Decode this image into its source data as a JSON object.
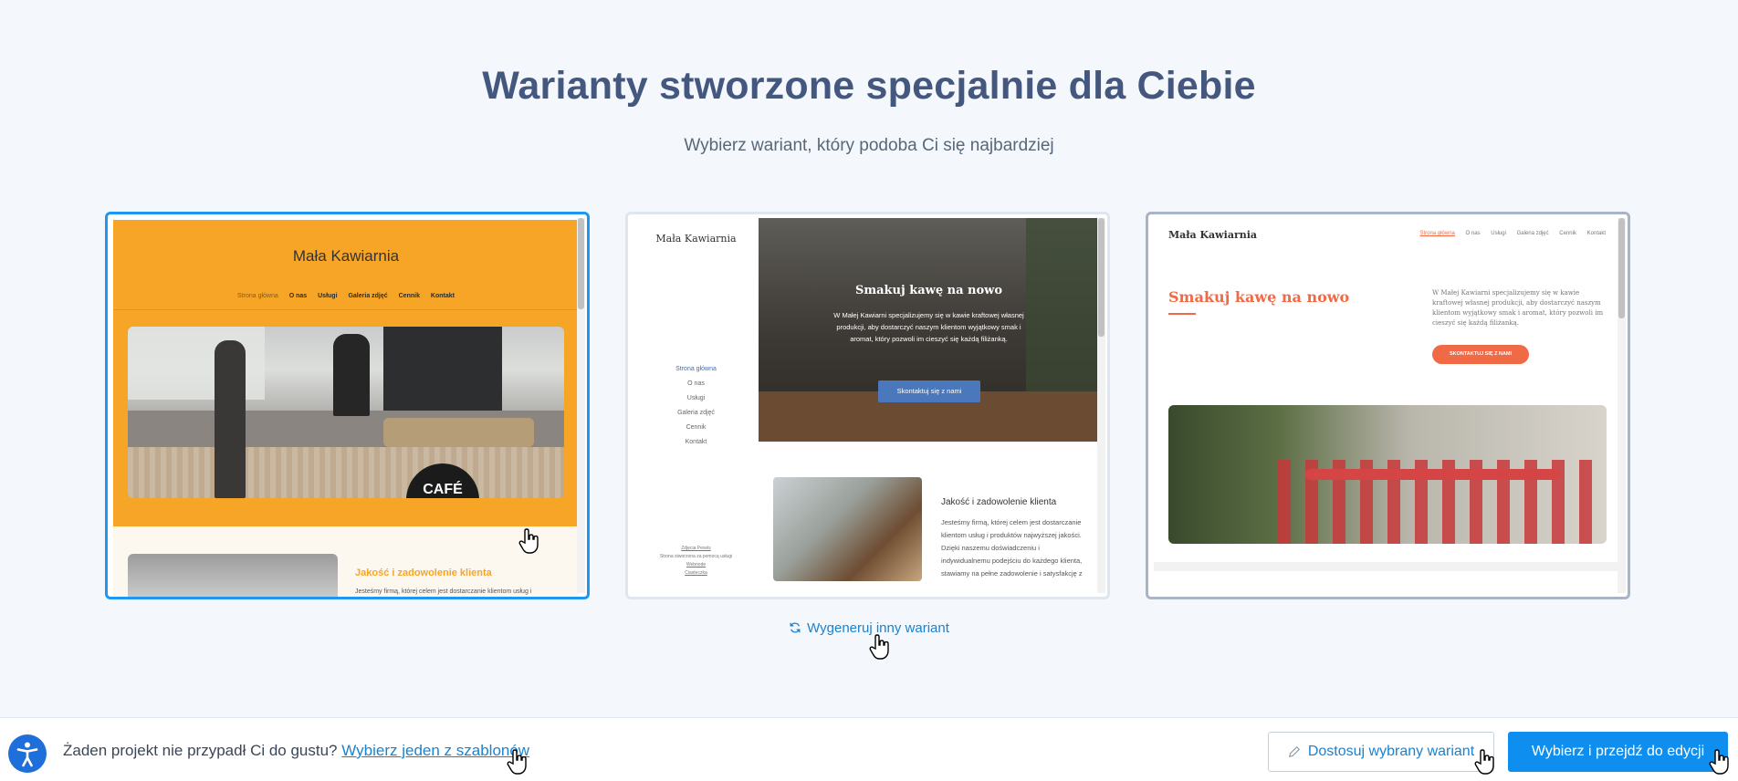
{
  "header": {
    "title": "Warianty stworzone specjalnie dla Ciebie",
    "subtitle": "Wybierz wariant, który podoba Ci się najbardziej"
  },
  "variants": [
    {
      "site_title": "Mała Kawiarnia",
      "nav": [
        "Strona główna",
        "O nas",
        "Usługi",
        "Galeria zdjęć",
        "Cennik",
        "Kontakt"
      ],
      "section_title": "Jakość i zadowolenie klienta",
      "section_text": "Jesteśmy firmą, której celem jest dostarczanie klientom usług i",
      "photo_sign": "CAFÉ",
      "accent_color": "#f7a527",
      "selected": true
    },
    {
      "site_title": "Mała Kawiarnia",
      "nav": [
        "Strona główna",
        "O nas",
        "Usługi",
        "Galeria zdjęć",
        "Cennik",
        "Kontakt"
      ],
      "hero_title": "Smakuj kawę na nowo",
      "hero_text": "W Małej Kawiarni specjalizujemy się w kawie kraftowej własnej produkcji, aby dostarczyć naszym klientom wyjątkowy smak i aromat, który pozwoli im cieszyć się każdą filiżanką.",
      "hero_button": "Skontaktuj się z nami",
      "section_title": "Jakość i zadowolenie klienta",
      "section_text": "Jesteśmy firmą, której celem jest dostarczanie klientom usług i produktów najwyższej jakości. Dzięki naszemu doświadczeniu i indywidualnemu podejściu do każdego klienta, stawiamy na pełne zadowolenie i satysfakcję z",
      "footer_links": [
        "Zdjęcia Pexels",
        "Strona stworzona za pomocą usługi",
        "Webnode",
        "Ciasteczka"
      ],
      "accent_color": "#3f6fb5"
    },
    {
      "site_title": "Mała Kawiarnia",
      "nav": [
        "Strona główna",
        "O nas",
        "Usługi",
        "Galeria zdjęć",
        "Cennik",
        "Kontakt"
      ],
      "hero_title": "Smakuj kawę na nowo",
      "hero_text": "W Małej Kawiarni specjalizujemy się w kawie kraftowej własnej produkcji, aby dostarczyć naszym klientom wyjątkowy smak i aromat, który pozwoli im cieszyć się każdą filiżanką.",
      "hero_button": "SKONTAKTUJ SIĘ Z NAMI",
      "accent_color": "#f06a45"
    }
  ],
  "regenerate_label": "Wygeneruj inny wariant",
  "bottom_bar": {
    "prompt": "Żaden projekt nie przypadł Ci do gustu?",
    "link": "Wybierz jeden z szablonów",
    "customize_label": "Dostosuj wybrany wariant",
    "primary_label": "Wybierz i przejdź do edycji"
  },
  "icons": {
    "accessibility": "accessibility-icon",
    "regenerate": "refresh-icon",
    "customize": "pencil-icon",
    "cursor": "hand-pointer-icon"
  },
  "colors": {
    "title": "#44587f",
    "link": "#1b82cf",
    "primary": "#0e8ff0",
    "selected_border": "#1e97f0"
  }
}
